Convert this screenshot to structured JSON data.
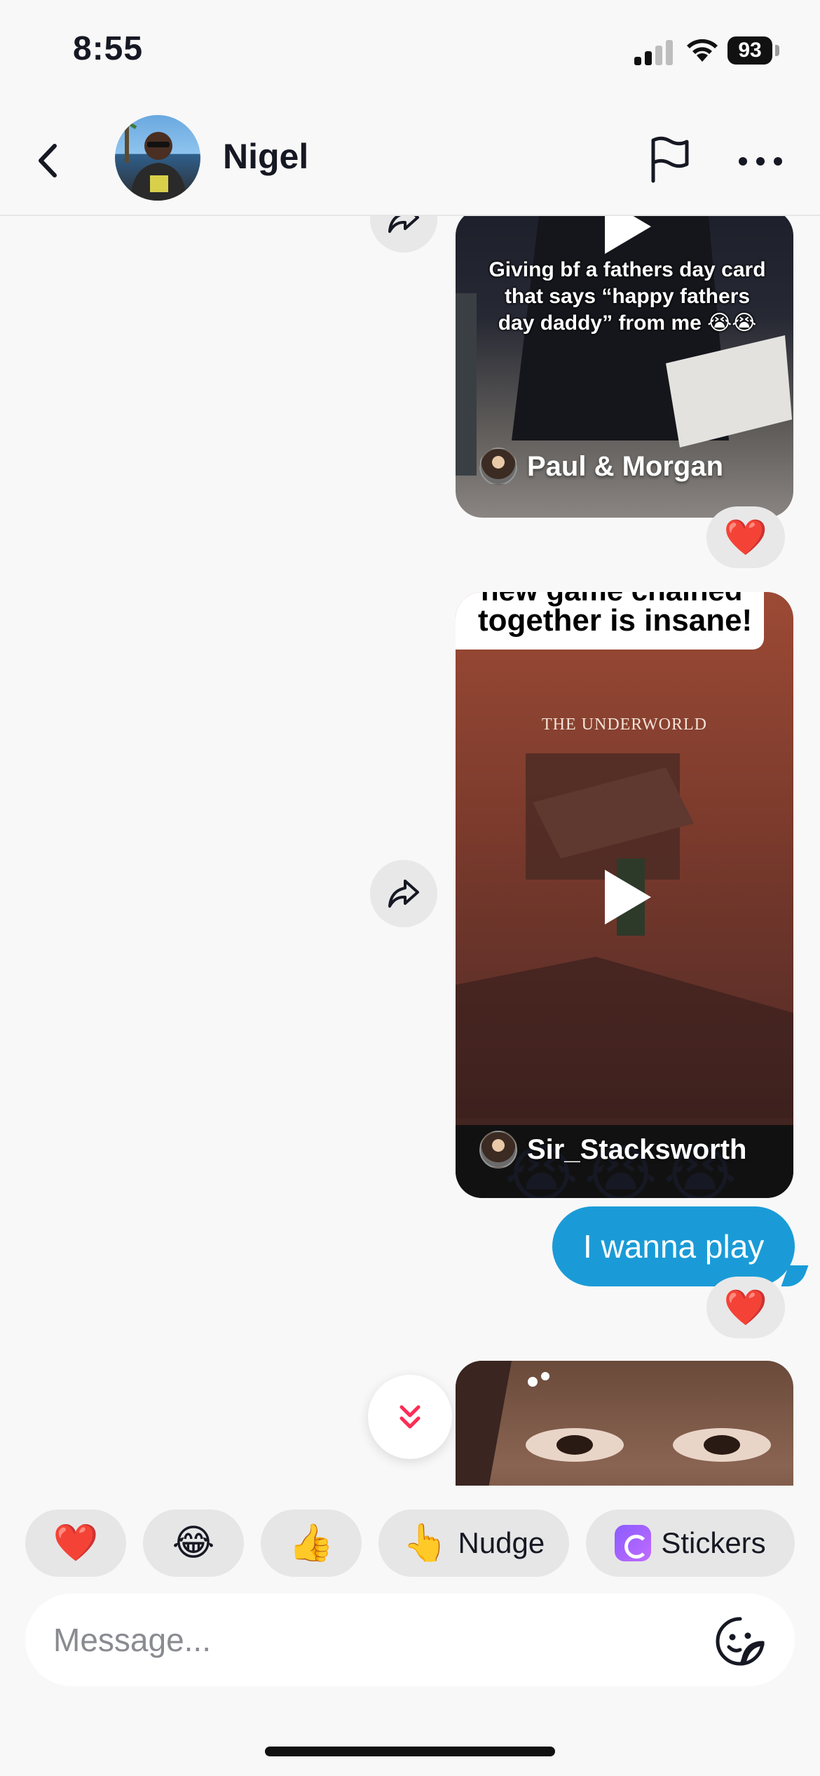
{
  "status_bar": {
    "time": "8:55",
    "battery": "93"
  },
  "header": {
    "contact_name": "Nigel"
  },
  "messages": {
    "video1": {
      "caption": "Giving bf a fathers day card that says “happy fathers day daddy” from me 😭😭",
      "author": "Paul & Morgan",
      "reaction": "❤️"
    },
    "video2": {
      "caption_top": "new game chained",
      "caption": "together is insane!",
      "scene_title": "THE UNDERWORLD",
      "author": "Sir_Stacksworth",
      "overlay_emojis": "😭😭😭"
    },
    "text1": {
      "text": "I wanna play",
      "reaction": "❤️"
    }
  },
  "quick_reactions": [
    {
      "emoji": "❤️",
      "label": ""
    },
    {
      "emoji": "😂",
      "label": ""
    },
    {
      "emoji": "👍",
      "label": ""
    },
    {
      "emoji": "👆",
      "label": "Nudge"
    },
    {
      "emoji": "",
      "label": "Stickers"
    }
  ],
  "composer": {
    "placeholder": "Message..."
  },
  "colors": {
    "bubble": "#1a9bd7",
    "accent": "#fe2c55",
    "background": "#f8f8f8"
  },
  "icons": [
    "back-icon",
    "flag-icon",
    "more-icon",
    "share-icon",
    "play-icon",
    "chevron-double-down-icon",
    "sticker-face-icon"
  ]
}
